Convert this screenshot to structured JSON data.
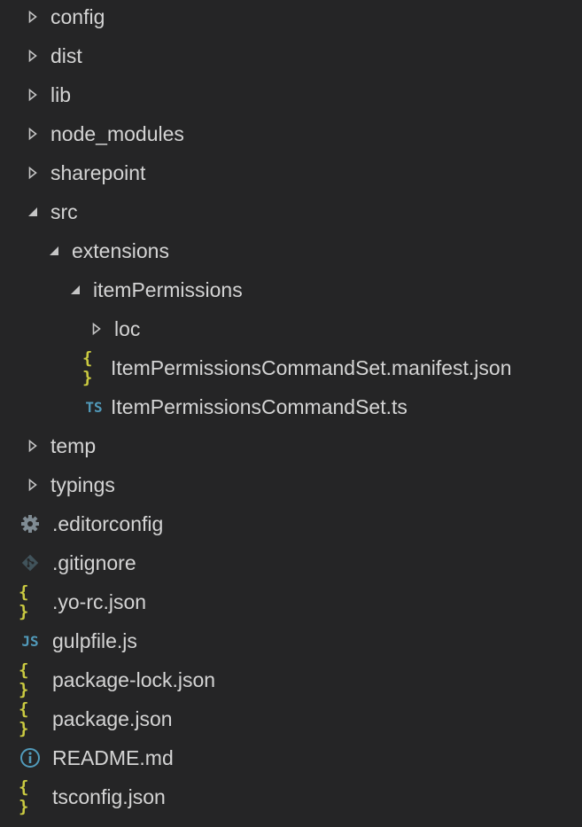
{
  "explorer": {
    "items": [
      {
        "label": "config",
        "kind": "folder",
        "state": "collapsed",
        "depth": 0
      },
      {
        "label": "dist",
        "kind": "folder",
        "state": "collapsed",
        "depth": 0
      },
      {
        "label": "lib",
        "kind": "folder",
        "state": "collapsed",
        "depth": 0
      },
      {
        "label": "node_modules",
        "kind": "folder",
        "state": "collapsed",
        "depth": 0
      },
      {
        "label": "sharepoint",
        "kind": "folder",
        "state": "collapsed",
        "depth": 0
      },
      {
        "label": "src",
        "kind": "folder",
        "state": "expanded",
        "depth": 0
      },
      {
        "label": "extensions",
        "kind": "folder",
        "state": "expanded",
        "depth": 1
      },
      {
        "label": "itemPermissions",
        "kind": "folder",
        "state": "expanded",
        "depth": 2
      },
      {
        "label": "loc",
        "kind": "folder",
        "state": "collapsed",
        "depth": 3
      },
      {
        "label": "ItemPermissionsCommandSet.manifest.json",
        "kind": "file",
        "icon": "json-braces-icon",
        "icon_text": "{ }",
        "depth": 3
      },
      {
        "label": "ItemPermissionsCommandSet.ts",
        "kind": "file",
        "icon": "typescript-icon",
        "icon_text": "TS",
        "depth": 3
      },
      {
        "label": "temp",
        "kind": "folder",
        "state": "collapsed",
        "depth": 0
      },
      {
        "label": "typings",
        "kind": "folder",
        "state": "collapsed",
        "depth": 0
      },
      {
        "label": ".editorconfig",
        "kind": "file",
        "icon": "gear-icon",
        "depth": 0
      },
      {
        "label": ".gitignore",
        "kind": "file",
        "icon": "git-icon",
        "depth": 0
      },
      {
        "label": ".yo-rc.json",
        "kind": "file",
        "icon": "json-braces-icon",
        "icon_text": "{ }",
        "depth": 0
      },
      {
        "label": "gulpfile.js",
        "kind": "file",
        "icon": "javascript-icon",
        "icon_text": "JS",
        "depth": 0
      },
      {
        "label": "package-lock.json",
        "kind": "file",
        "icon": "json-braces-icon",
        "icon_text": "{ }",
        "depth": 0
      },
      {
        "label": "package.json",
        "kind": "file",
        "icon": "json-braces-icon",
        "icon_text": "{ }",
        "depth": 0
      },
      {
        "label": "README.md",
        "kind": "file",
        "icon": "info-icon",
        "depth": 0
      },
      {
        "label": "tsconfig.json",
        "kind": "file",
        "icon": "json-braces-icon",
        "icon_text": "{ }",
        "depth": 0
      }
    ]
  },
  "colors": {
    "background": "#252526",
    "text": "#d4d4d4",
    "twistie": "#c5c5c5",
    "json": "#cbcb41",
    "ts_js": "#519aba",
    "gear": "#7f8b93",
    "git": "#41535b",
    "info": "#519aba"
  }
}
